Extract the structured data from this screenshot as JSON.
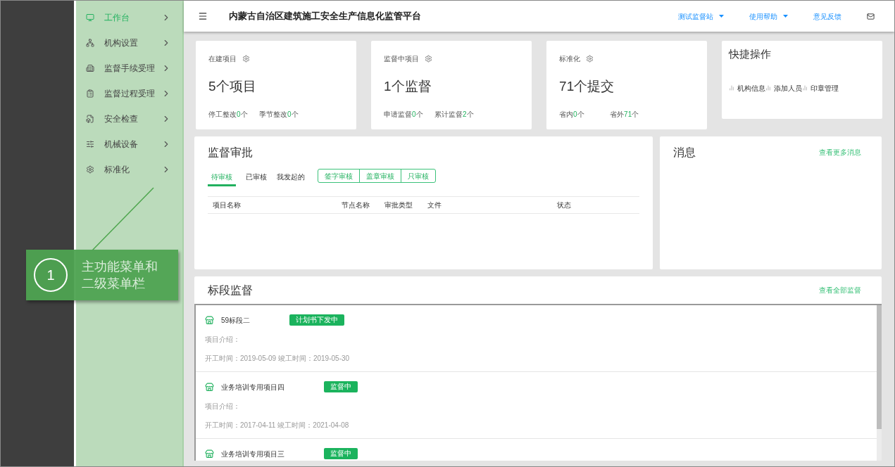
{
  "sidebar": {
    "items": [
      {
        "label": "工作台",
        "selected": true
      },
      {
        "label": "机构设置",
        "selected": false
      },
      {
        "label": "监督手续受理",
        "selected": false
      },
      {
        "label": "监督过程受理",
        "selected": false
      },
      {
        "label": "安全检查",
        "selected": false
      },
      {
        "label": "机械设备",
        "selected": false
      },
      {
        "label": "标准化",
        "selected": false
      }
    ]
  },
  "header": {
    "title": "内蒙古自治区建筑施工安全生产信息化监管平台",
    "menu": [
      {
        "label": "测试监督站",
        "kind": "dropdown"
      },
      {
        "label": "使用帮助",
        "kind": "dropdown"
      },
      {
        "label": "意见反馈",
        "kind": "link"
      }
    ]
  },
  "stat_cards": [
    {
      "title": "在建项目",
      "value": "5个项目",
      "footer": [
        {
          "label": "停工整改",
          "count": "0",
          "unit": "个"
        },
        {
          "label": "季节整改",
          "count": "0",
          "unit": "个"
        }
      ]
    },
    {
      "title": "监督中项目",
      "value": "1个监督",
      "footer": [
        {
          "label": "申请监督",
          "count": "0",
          "unit": "个"
        },
        {
          "label": "累计监督",
          "count": "2",
          "unit": "个"
        }
      ]
    },
    {
      "title": "标准化",
      "value": "71个提交",
      "footer": [
        {
          "label": "省内",
          "count": "0",
          "unit": "个"
        },
        {
          "label": "省外",
          "count": "71",
          "unit": "个"
        }
      ]
    }
  ],
  "quick_actions": {
    "title": "快捷操作",
    "items": [
      "机构信息",
      "添加人员",
      "印章管理"
    ]
  },
  "approval": {
    "title": "监督审批",
    "tabs": [
      {
        "label": "待审核",
        "selected": true
      },
      {
        "label": "已审核",
        "selected": false
      },
      {
        "label": "我发起的",
        "selected": false
      }
    ],
    "filters": [
      "签字审核",
      "盖章审核",
      "只审核"
    ],
    "columns": [
      "项目名称",
      "节点名称",
      "审批类型",
      "文件",
      "状态"
    ]
  },
  "messages": {
    "title": "消息",
    "link": "查看更多消息"
  },
  "sections": {
    "title": "标段监督",
    "link": "查看全部监督",
    "items": [
      {
        "name": "59标段二",
        "status": "计划书下发中",
        "intro": "项目介绍：",
        "dates": "开工时间：2019-05-09 竣工时间：2019-05-30"
      },
      {
        "name": "业务培训专用项目四",
        "status": "监督中",
        "intro": "项目介绍：",
        "dates": "开工时间：2017-04-11 竣工时间：2021-04-08"
      },
      {
        "name": "业务培训专用项目三",
        "status": "监督中"
      }
    ]
  },
  "callout": {
    "number": "1",
    "lines": [
      "主功能菜单和",
      "二级菜单栏"
    ]
  }
}
